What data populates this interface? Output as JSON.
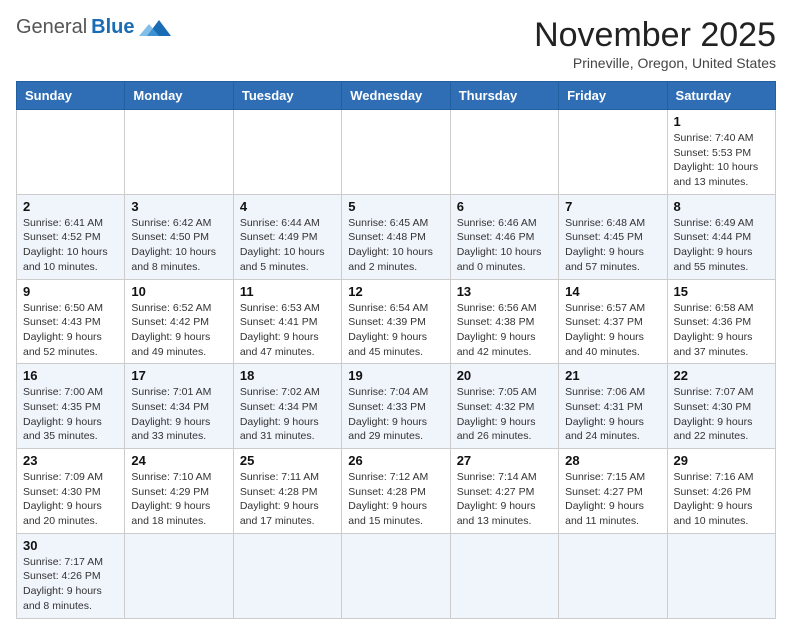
{
  "header": {
    "logo_general": "General",
    "logo_blue": "Blue",
    "month_title": "November 2025",
    "location": "Prineville, Oregon, United States"
  },
  "days_of_week": [
    "Sunday",
    "Monday",
    "Tuesday",
    "Wednesday",
    "Thursday",
    "Friday",
    "Saturday"
  ],
  "weeks": [
    {
      "cells": [
        {
          "day": null,
          "info": null
        },
        {
          "day": null,
          "info": null
        },
        {
          "day": null,
          "info": null
        },
        {
          "day": null,
          "info": null
        },
        {
          "day": null,
          "info": null
        },
        {
          "day": null,
          "info": null
        },
        {
          "day": "1",
          "info": "Sunrise: 7:40 AM\nSunset: 5:53 PM\nDaylight: 10 hours\nand 13 minutes."
        }
      ]
    },
    {
      "cells": [
        {
          "day": "2",
          "info": "Sunrise: 6:41 AM\nSunset: 4:52 PM\nDaylight: 10 hours\nand 10 minutes."
        },
        {
          "day": "3",
          "info": "Sunrise: 6:42 AM\nSunset: 4:50 PM\nDaylight: 10 hours\nand 8 minutes."
        },
        {
          "day": "4",
          "info": "Sunrise: 6:44 AM\nSunset: 4:49 PM\nDaylight: 10 hours\nand 5 minutes."
        },
        {
          "day": "5",
          "info": "Sunrise: 6:45 AM\nSunset: 4:48 PM\nDaylight: 10 hours\nand 2 minutes."
        },
        {
          "day": "6",
          "info": "Sunrise: 6:46 AM\nSunset: 4:46 PM\nDaylight: 10 hours\nand 0 minutes."
        },
        {
          "day": "7",
          "info": "Sunrise: 6:48 AM\nSunset: 4:45 PM\nDaylight: 9 hours\nand 57 minutes."
        },
        {
          "day": "8",
          "info": "Sunrise: 6:49 AM\nSunset: 4:44 PM\nDaylight: 9 hours\nand 55 minutes."
        }
      ]
    },
    {
      "cells": [
        {
          "day": "9",
          "info": "Sunrise: 6:50 AM\nSunset: 4:43 PM\nDaylight: 9 hours\nand 52 minutes."
        },
        {
          "day": "10",
          "info": "Sunrise: 6:52 AM\nSunset: 4:42 PM\nDaylight: 9 hours\nand 49 minutes."
        },
        {
          "day": "11",
          "info": "Sunrise: 6:53 AM\nSunset: 4:41 PM\nDaylight: 9 hours\nand 47 minutes."
        },
        {
          "day": "12",
          "info": "Sunrise: 6:54 AM\nSunset: 4:39 PM\nDaylight: 9 hours\nand 45 minutes."
        },
        {
          "day": "13",
          "info": "Sunrise: 6:56 AM\nSunset: 4:38 PM\nDaylight: 9 hours\nand 42 minutes."
        },
        {
          "day": "14",
          "info": "Sunrise: 6:57 AM\nSunset: 4:37 PM\nDaylight: 9 hours\nand 40 minutes."
        },
        {
          "day": "15",
          "info": "Sunrise: 6:58 AM\nSunset: 4:36 PM\nDaylight: 9 hours\nand 37 minutes."
        }
      ]
    },
    {
      "cells": [
        {
          "day": "16",
          "info": "Sunrise: 7:00 AM\nSunset: 4:35 PM\nDaylight: 9 hours\nand 35 minutes."
        },
        {
          "day": "17",
          "info": "Sunrise: 7:01 AM\nSunset: 4:34 PM\nDaylight: 9 hours\nand 33 minutes."
        },
        {
          "day": "18",
          "info": "Sunrise: 7:02 AM\nSunset: 4:34 PM\nDaylight: 9 hours\nand 31 minutes."
        },
        {
          "day": "19",
          "info": "Sunrise: 7:04 AM\nSunset: 4:33 PM\nDaylight: 9 hours\nand 29 minutes."
        },
        {
          "day": "20",
          "info": "Sunrise: 7:05 AM\nSunset: 4:32 PM\nDaylight: 9 hours\nand 26 minutes."
        },
        {
          "day": "21",
          "info": "Sunrise: 7:06 AM\nSunset: 4:31 PM\nDaylight: 9 hours\nand 24 minutes."
        },
        {
          "day": "22",
          "info": "Sunrise: 7:07 AM\nSunset: 4:30 PM\nDaylight: 9 hours\nand 22 minutes."
        }
      ]
    },
    {
      "cells": [
        {
          "day": "23",
          "info": "Sunrise: 7:09 AM\nSunset: 4:30 PM\nDaylight: 9 hours\nand 20 minutes."
        },
        {
          "day": "24",
          "info": "Sunrise: 7:10 AM\nSunset: 4:29 PM\nDaylight: 9 hours\nand 18 minutes."
        },
        {
          "day": "25",
          "info": "Sunrise: 7:11 AM\nSunset: 4:28 PM\nDaylight: 9 hours\nand 17 minutes."
        },
        {
          "day": "26",
          "info": "Sunrise: 7:12 AM\nSunset: 4:28 PM\nDaylight: 9 hours\nand 15 minutes."
        },
        {
          "day": "27",
          "info": "Sunrise: 7:14 AM\nSunset: 4:27 PM\nDaylight: 9 hours\nand 13 minutes."
        },
        {
          "day": "28",
          "info": "Sunrise: 7:15 AM\nSunset: 4:27 PM\nDaylight: 9 hours\nand 11 minutes."
        },
        {
          "day": "29",
          "info": "Sunrise: 7:16 AM\nSunset: 4:26 PM\nDaylight: 9 hours\nand 10 minutes."
        }
      ]
    },
    {
      "cells": [
        {
          "day": "30",
          "info": "Sunrise: 7:17 AM\nSunset: 4:26 PM\nDaylight: 9 hours\nand 8 minutes."
        },
        {
          "day": null,
          "info": null
        },
        {
          "day": null,
          "info": null
        },
        {
          "day": null,
          "info": null
        },
        {
          "day": null,
          "info": null
        },
        {
          "day": null,
          "info": null
        },
        {
          "day": null,
          "info": null
        }
      ]
    }
  ]
}
